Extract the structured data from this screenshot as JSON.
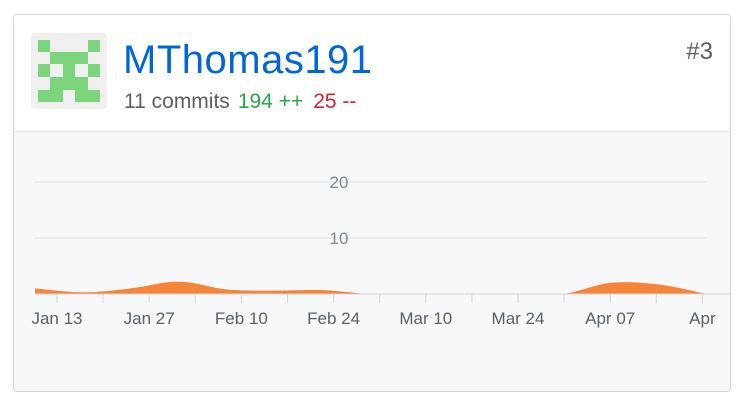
{
  "user": {
    "username": "MThomas191",
    "rank": "#3",
    "commits": "11 commits",
    "additions": "194 ++",
    "deletions": "25 --"
  },
  "avatar": {
    "icon": "identicon",
    "color": "#7cd47c",
    "background": "#f0f0f0"
  },
  "colors": {
    "link": "#0366d6",
    "additions": "#28a745",
    "deletions": "#cb2431",
    "area": "#f6853a"
  },
  "chart_data": {
    "type": "area",
    "y_ticks": [
      "10",
      "20"
    ],
    "ylim": [
      0,
      20
    ],
    "x_ticks": [
      "Jan 13",
      "Jan 27",
      "Feb 10",
      "Feb 24",
      "Mar 10",
      "Mar 24",
      "Apr 07",
      "Apr"
    ],
    "series": [
      {
        "x": [
          "Jan 06",
          "Jan 13",
          "Jan 20",
          "Jan 27",
          "Feb 03",
          "Feb 10",
          "Feb 17",
          "Feb 24",
          "Mar 03",
          "Mar 10",
          "Mar 17",
          "Mar 24",
          "Mar 31",
          "Apr 07",
          "Apr 14"
        ],
        "values": [
          1,
          0.3,
          1,
          2.2,
          0.8,
          0.6,
          0.7,
          0,
          0,
          0,
          0,
          0,
          2,
          1.7,
          0
        ]
      }
    ]
  }
}
